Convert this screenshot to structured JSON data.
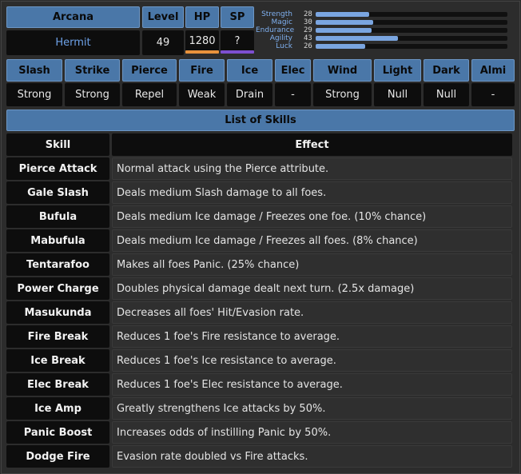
{
  "persona": {
    "arcana_label": "Arcana",
    "arcana_value": "Hermit",
    "level_label": "Level",
    "level_value": "49",
    "hp_label": "HP",
    "hp_value": "1280",
    "sp_label": "SP",
    "sp_value": "?"
  },
  "colors": {
    "header_blue": "#4a77a8",
    "hp_bar": "#e8923c",
    "sp_bar": "#7d4fd0",
    "stat_bar": "#7aa5e0"
  },
  "stats": [
    {
      "label": "Strength",
      "value": "28",
      "fraction": 0.28
    },
    {
      "label": "Magic",
      "value": "30",
      "fraction": 0.3
    },
    {
      "label": "Endurance",
      "value": "29",
      "fraction": 0.29
    },
    {
      "label": "Agility",
      "value": "43",
      "fraction": 0.43
    },
    {
      "label": "Luck",
      "value": "26",
      "fraction": 0.26
    }
  ],
  "resistances": {
    "headers": [
      "Slash",
      "Strike",
      "Pierce",
      "Fire",
      "Ice",
      "Elec",
      "Wind",
      "Light",
      "Dark",
      "Almi"
    ],
    "values": [
      "Strong",
      "Strong",
      "Repel",
      "Weak",
      "Drain",
      "-",
      "Strong",
      "Null",
      "Null",
      "-"
    ]
  },
  "skills": {
    "title": "List of Skills",
    "col_skill": "Skill",
    "col_effect": "Effect",
    "rows": [
      {
        "name": "Pierce Attack",
        "effect": "Normal attack using the Pierce attribute."
      },
      {
        "name": "Gale Slash",
        "effect": "Deals medium Slash damage to all foes."
      },
      {
        "name": "Bufula",
        "effect": "Deals medium Ice damage / Freezes one foe. (10% chance)"
      },
      {
        "name": "Mabufula",
        "effect": "Deals medium Ice damage / Freezes all foes. (8% chance)"
      },
      {
        "name": "Tentarafoo",
        "effect": "Makes all foes Panic. (25% chance)"
      },
      {
        "name": "Power Charge",
        "effect": "Doubles physical damage dealt next turn. (2.5x damage)"
      },
      {
        "name": "Masukunda",
        "effect": "Decreases all foes' Hit/Evasion rate."
      },
      {
        "name": "Fire Break",
        "effect": "Reduces 1 foe's Fire resistance to average."
      },
      {
        "name": "Ice Break",
        "effect": "Reduces 1 foe's Ice resistance to average."
      },
      {
        "name": "Elec Break",
        "effect": "Reduces 1 foe's Elec resistance to average."
      },
      {
        "name": "Ice Amp",
        "effect": "Greatly strengthens Ice attacks by 50%."
      },
      {
        "name": "Panic Boost",
        "effect": "Increases odds of instilling Panic by 50%."
      },
      {
        "name": "Dodge Fire",
        "effect": "Evasion rate doubled vs Fire attacks."
      }
    ]
  }
}
